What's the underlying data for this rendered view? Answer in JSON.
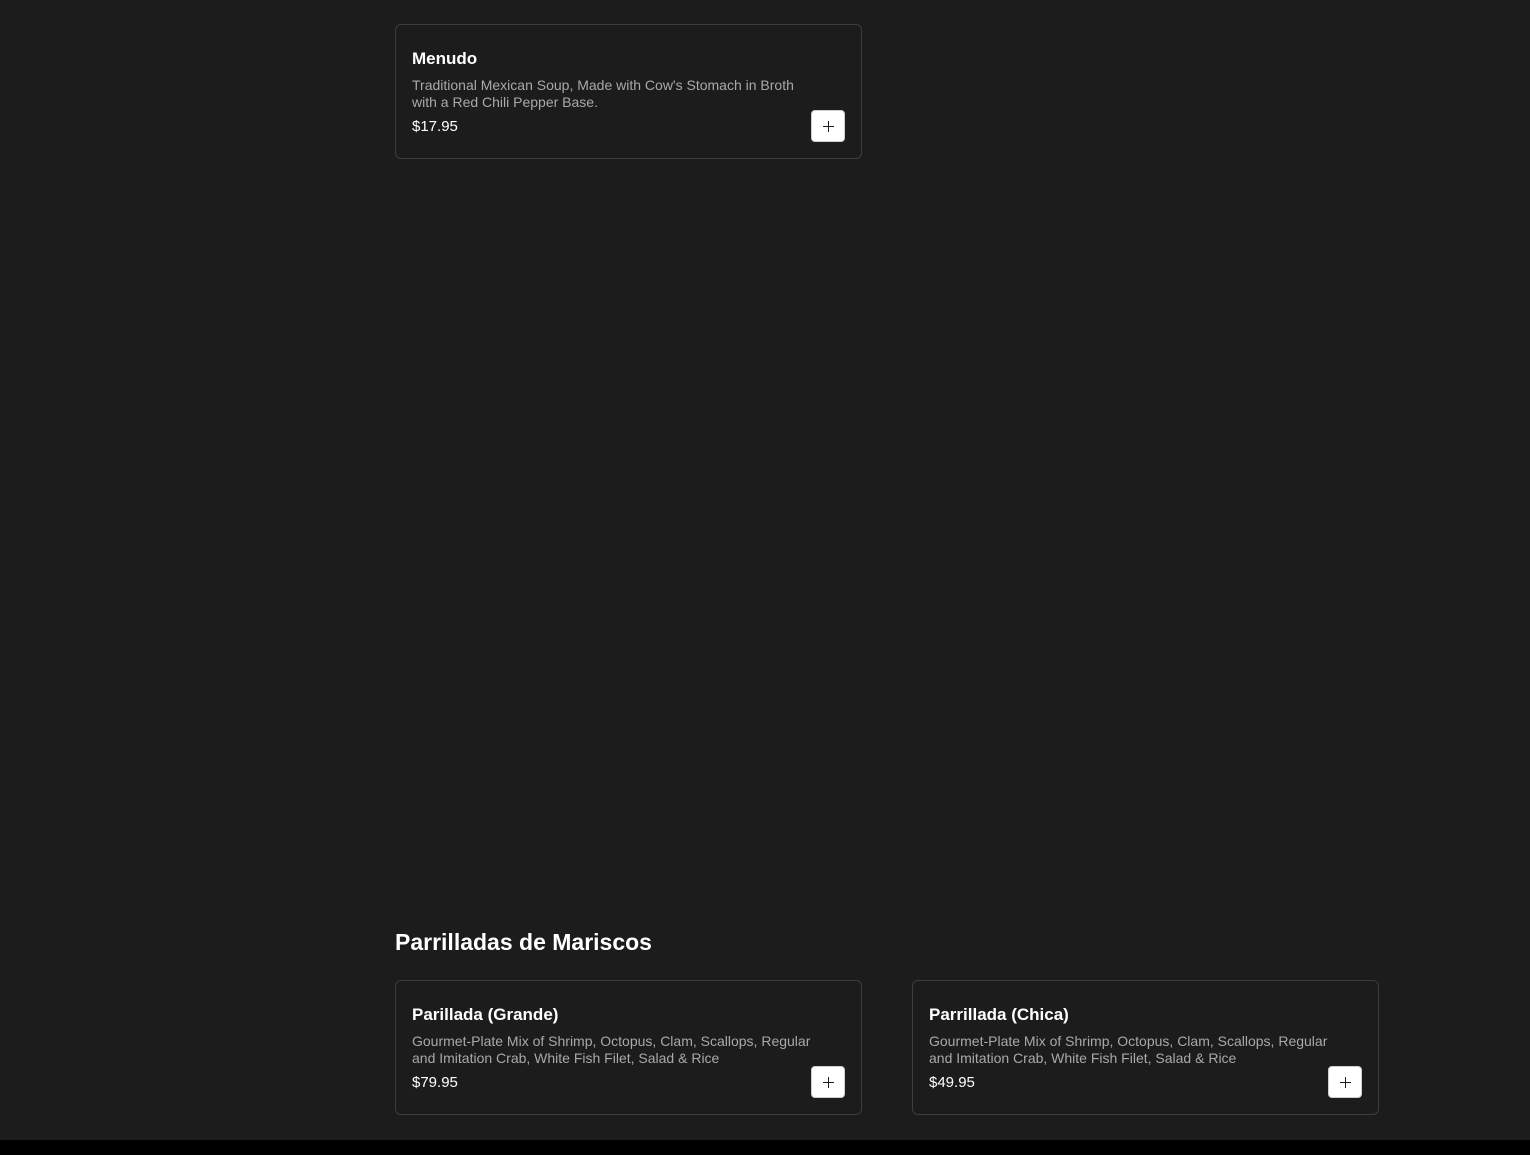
{
  "sections": [
    {
      "items": [
        {
          "name": "Menudo",
          "description": "Traditional Mexican Soup, Made with Cow's Stomach in Broth with a Red Chili Pepper Base.",
          "price": "$17.95",
          "add_label": "+"
        }
      ]
    },
    {
      "title": "Parrilladas de Mariscos",
      "items": [
        {
          "name": "Parillada (Grande)",
          "description": "Gourmet-Plate Mix of Shrimp, Octopus, Clam, Scallops, Regular and Imitation Crab, White Fish Filet, Salad & Rice",
          "price": "$79.95",
          "add_label": "+"
        },
        {
          "name": "Parrillada (Chica)",
          "description": "Gourmet-Plate Mix of Shrimp, Octopus, Clam, Scallops, Regular and Imitation Crab, White Fish Filet, Salad & Rice",
          "price": "$49.95",
          "add_label": "+"
        }
      ]
    }
  ],
  "colors": {
    "background": "#1c1c1c",
    "card_border": "#3d3d3d",
    "description_text": "#a9a9a9",
    "footer": "#000000"
  },
  "icons": {
    "add": "plus-icon"
  }
}
